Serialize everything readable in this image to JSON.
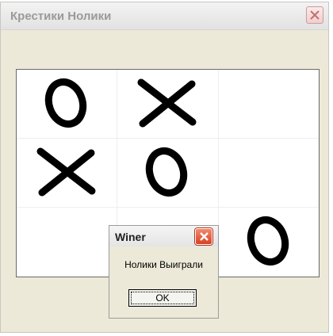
{
  "window": {
    "title": "Крестики Нолики"
  },
  "board": {
    "cells": [
      "O",
      "X",
      "",
      "X",
      "O",
      "",
      "",
      "",
      "O"
    ]
  },
  "dialog": {
    "title": "Winer",
    "message": "Нолики Выиграли",
    "ok_label": "OK"
  },
  "colors": {
    "close_button": "#d64224",
    "mark": "#000000"
  }
}
